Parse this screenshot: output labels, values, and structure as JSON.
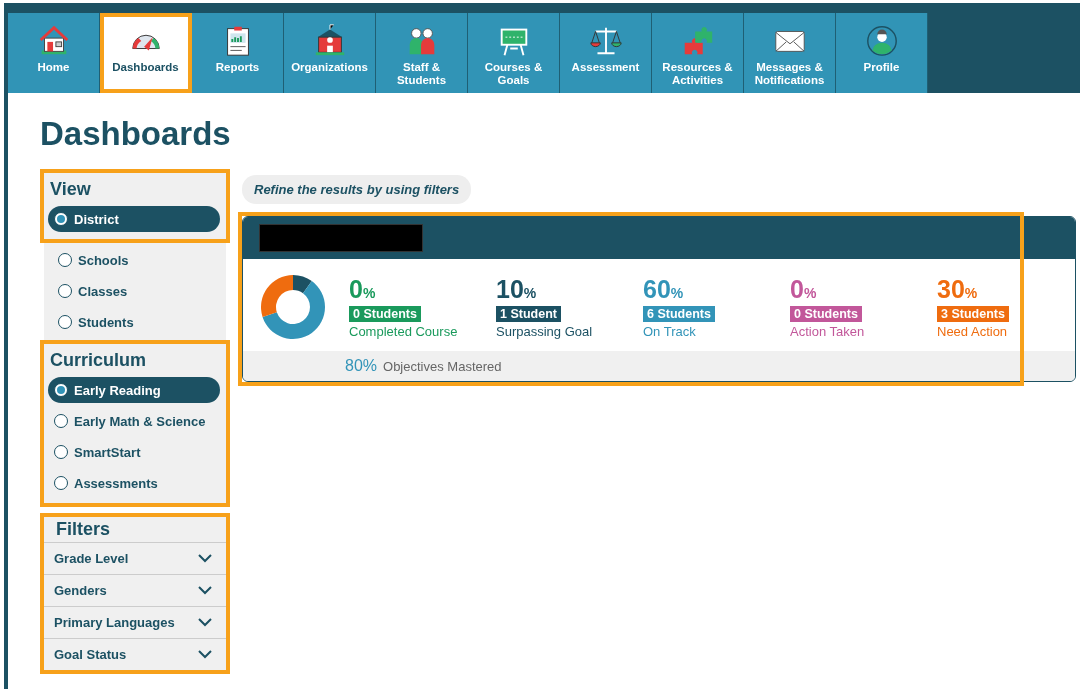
{
  "nav": [
    {
      "label": "Home",
      "kind": "house",
      "selected": false,
      "highlighted": false
    },
    {
      "label": "Dashboards",
      "kind": "gauge",
      "selected": true,
      "highlighted": true
    },
    {
      "label": "Reports",
      "kind": "clipboard",
      "selected": false,
      "highlighted": false
    },
    {
      "label": "Organizations",
      "kind": "school",
      "selected": false,
      "highlighted": false
    },
    {
      "label": "Staff & Students",
      "kind": "people",
      "selected": false,
      "highlighted": false
    },
    {
      "label": "Courses & Goals",
      "kind": "board",
      "selected": false,
      "highlighted": false
    },
    {
      "label": "Assessment",
      "kind": "scale",
      "selected": false,
      "highlighted": false
    },
    {
      "label": "Resources & Activities",
      "kind": "puzzle",
      "selected": false,
      "highlighted": false
    },
    {
      "label": "Messages & Notifications",
      "kind": "envelope",
      "selected": false,
      "highlighted": false
    },
    {
      "label": "Profile",
      "kind": "person",
      "selected": false,
      "highlighted": false
    }
  ],
  "page_title": "Dashboards",
  "view": {
    "title": "View",
    "highlighted": true,
    "options": [
      {
        "label": "District",
        "selected": true,
        "highlighted": true
      },
      {
        "label": "Schools",
        "selected": false,
        "highlighted": false
      },
      {
        "label": "Classes",
        "selected": false,
        "highlighted": false
      },
      {
        "label": "Students",
        "selected": false,
        "highlighted": false
      }
    ]
  },
  "curriculum": {
    "title": "Curriculum",
    "highlighted": true,
    "options": [
      {
        "label": "Early Reading",
        "selected": true,
        "highlighted": true
      },
      {
        "label": "Early Math & Science",
        "selected": false,
        "highlighted": true
      },
      {
        "label": "SmartStart",
        "selected": false,
        "highlighted": true
      },
      {
        "label": "Assessments",
        "selected": false,
        "highlighted": true
      }
    ]
  },
  "filters": {
    "title": "Filters",
    "highlighted": true,
    "items": [
      {
        "label": "Grade Level",
        "expanded": false
      },
      {
        "label": "Genders",
        "expanded": false
      },
      {
        "label": "Primary Languages",
        "expanded": false
      },
      {
        "label": "Goal Status",
        "expanded": false
      }
    ]
  },
  "filter_hint": "Refine the results by using filters",
  "summary": {
    "highlighted": true,
    "title_redacted": true,
    "stats": [
      {
        "value": "0",
        "unit": "%",
        "count": "0 Students",
        "label": "Completed Course",
        "color": "#1a9a5c"
      },
      {
        "value": "10",
        "unit": "%",
        "count": "1 Student",
        "label": "Surpassing Goal",
        "color": "#1c5163"
      },
      {
        "value": "60",
        "unit": "%",
        "count": "6 Students",
        "label": "On Track",
        "color": "#3294b8"
      },
      {
        "value": "0",
        "unit": "%",
        "count": "0 Students",
        "label": "Action Taken",
        "color": "#c2579a"
      },
      {
        "value": "30",
        "unit": "%",
        "count": "3 Students",
        "label": "Need Action",
        "color": "#ef6c0f"
      }
    ],
    "footer_value": "80%",
    "footer_label": "Objectives Mastered"
  }
}
